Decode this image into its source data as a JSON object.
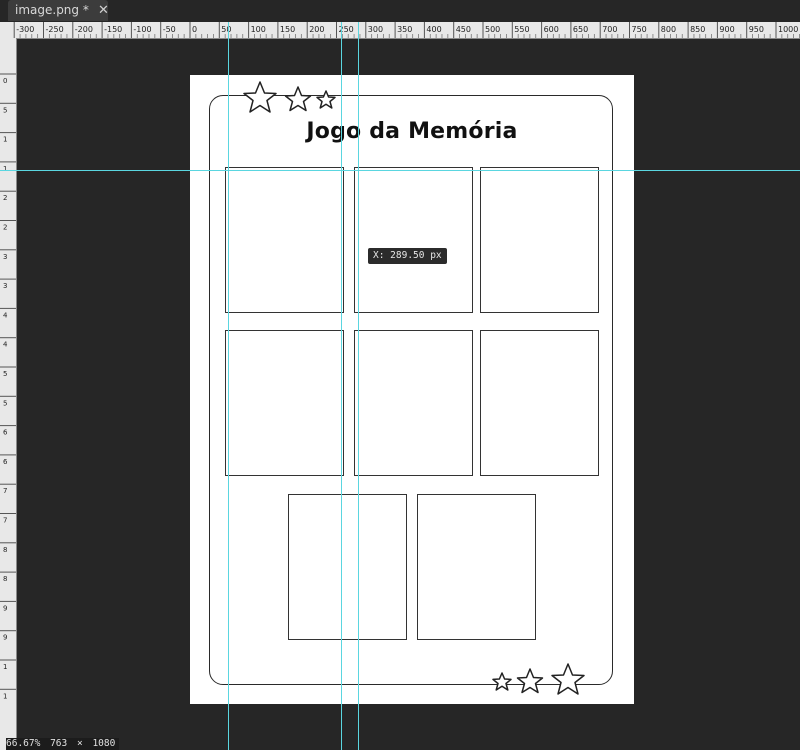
{
  "window": {
    "tab_title": "image.png *",
    "close_glyph": "✕"
  },
  "rulers": {
    "top_labels": [
      "-300",
      "-250",
      "-200",
      "-150",
      "-100",
      "-50",
      "0",
      "50",
      "100",
      "150",
      "200",
      "250",
      "300",
      "350",
      "400",
      "450",
      "500",
      "550",
      "600",
      "650",
      "700",
      "750",
      "800",
      "850",
      "900",
      "950",
      "1000"
    ],
    "left_labels": [
      "0",
      "50",
      "100",
      "150",
      "200",
      "250",
      "300",
      "350",
      "400",
      "450",
      "500",
      "550",
      "600",
      "650",
      "700",
      "750",
      "800",
      "850",
      "900",
      "950",
      "1000",
      "1050"
    ]
  },
  "document": {
    "title": "Jogo da Memória",
    "card_count": 8,
    "decoration_icons": [
      "star-icon",
      "star-icon",
      "star-icon"
    ]
  },
  "tooltip": {
    "coordinate": "X: 289.50 px"
  },
  "status": {
    "zoom": "66.67%",
    "width": "763",
    "height": "1080",
    "separator": "×"
  },
  "colors": {
    "canvas_bg": "#262626",
    "guide": "#5ad6e0",
    "page": "#ffffff",
    "ink": "#111111"
  }
}
